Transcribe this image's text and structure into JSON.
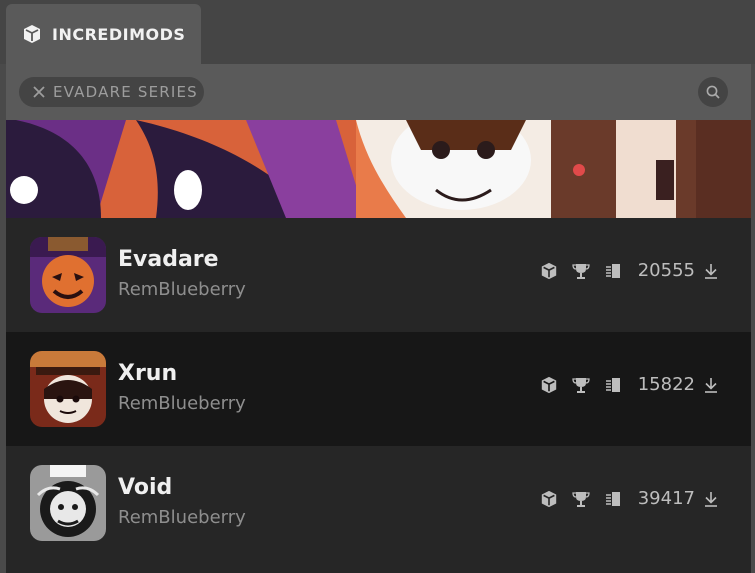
{
  "tab": {
    "label": "INCREDIMODS",
    "icon": "cube-icon"
  },
  "filter": {
    "label": "EVADARE SERIES",
    "icon": "close-icon"
  },
  "search": {
    "icon": "search-icon"
  },
  "mods": [
    {
      "title": "Evadare",
      "author": "RemBlueberry",
      "downloads": "20555"
    },
    {
      "title": "Xrun",
      "author": "RemBlueberry",
      "downloads": "15822"
    },
    {
      "title": "Void",
      "author": "RemBlueberry",
      "downloads": "39417"
    }
  ],
  "colors": {
    "background": "#4a4a4a",
    "panel": "#5a5a5a",
    "row_light": "#262626",
    "row_dark": "#171717",
    "title": "#f0f0f0",
    "author": "#8e8e8e"
  }
}
